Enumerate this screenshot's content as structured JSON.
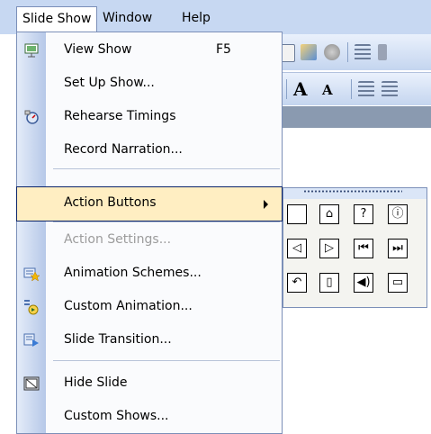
{
  "menubar": {
    "items": [
      {
        "label": "Slide Show"
      },
      {
        "label": "Window"
      },
      {
        "label": "Help"
      }
    ]
  },
  "menu": {
    "items": [
      {
        "label": "View Show",
        "shortcut": "F5",
        "icon": "slideshow-screen-icon"
      },
      {
        "label": "Set Up Show..."
      },
      {
        "label": "Rehearse Timings",
        "icon": "stopwatch-icon"
      },
      {
        "label": "Record Narration..."
      },
      {
        "label": "Action Buttons",
        "submenu": true
      },
      {
        "label": "Action Settings...",
        "disabled": true
      },
      {
        "label": "Animation Schemes...",
        "icon": "animation-schemes-icon"
      },
      {
        "label": "Custom Animation...",
        "icon": "custom-animation-icon"
      },
      {
        "label": "Slide Transition...",
        "icon": "slide-transition-icon"
      },
      {
        "label": "Hide Slide",
        "icon": "hide-slide-icon"
      },
      {
        "label": "Custom Shows..."
      }
    ]
  },
  "action_buttons": [
    {
      "name": "custom",
      "glyph": ""
    },
    {
      "name": "home",
      "glyph": "⌂"
    },
    {
      "name": "help",
      "glyph": "?"
    },
    {
      "name": "information",
      "glyph": "ⓘ"
    },
    {
      "name": "back-previous",
      "glyph": "◁"
    },
    {
      "name": "forward-next",
      "glyph": "▷"
    },
    {
      "name": "beginning",
      "glyph": "⏮"
    },
    {
      "name": "end",
      "glyph": "⏭"
    },
    {
      "name": "return",
      "glyph": "↶"
    },
    {
      "name": "document",
      "glyph": "▯"
    },
    {
      "name": "sound",
      "glyph": "◀)"
    },
    {
      "name": "movie",
      "glyph": "▭"
    }
  ],
  "toolbar": {
    "font_grow": "A",
    "font_shrink": "A"
  },
  "colors": {
    "menubar_bg": "#c7d8f2",
    "highlight_bg": "#ffeec2",
    "highlight_border": "#0a246a",
    "gutter": "#b6c8e8"
  }
}
